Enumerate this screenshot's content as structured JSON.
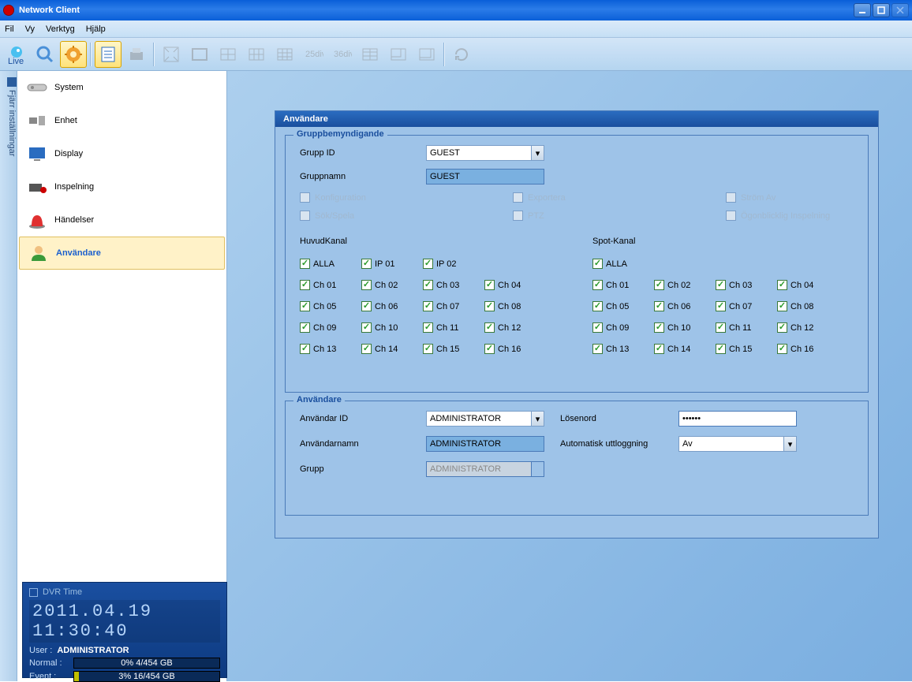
{
  "window": {
    "title": "Network Client"
  },
  "menu": {
    "fil": "Fil",
    "vy": "Vy",
    "verktyg": "Verktyg",
    "hjalp": "Hjälp"
  },
  "sidetab": {
    "label": "Fjärr inställningar"
  },
  "nav": {
    "system": "System",
    "enhet": "Enhet",
    "display": "Display",
    "inspelning": "Inspelning",
    "handelser": "Händelser",
    "anvandare": "Användare"
  },
  "panel": {
    "title": "Användare",
    "group_legend": "Gruppbemyndigande",
    "grupp_id_label": "Grupp ID",
    "grupp_id_value": "GUEST",
    "gruppnamn_label": "Gruppnamn",
    "gruppnamn_value": "GUEST",
    "perm_konfig": "Konfiguration",
    "perm_export": "Exportera",
    "perm_strom": "Ström Av",
    "perm_sok": "Sök/Spela",
    "perm_ptz": "PTZ",
    "perm_ogon": "Ögonblicklig Inspelning",
    "huvud_label": "HuvudKanal",
    "spot_label": "Spot-Kanal",
    "alla": "ALLA",
    "ip01": "IP 01",
    "ip02": "IP 02",
    "ch01": "Ch 01",
    "ch02": "Ch 02",
    "ch03": "Ch 03",
    "ch04": "Ch 04",
    "ch05": "Ch 05",
    "ch06": "Ch 06",
    "ch07": "Ch 07",
    "ch08": "Ch 08",
    "ch09": "Ch 09",
    "ch10": "Ch 10",
    "ch11": "Ch 11",
    "ch12": "Ch 12",
    "ch13": "Ch 13",
    "ch14": "Ch 14",
    "ch15": "Ch 15",
    "ch16": "Ch 16",
    "user_legend": "Användare",
    "anvandar_id_label": "Användar ID",
    "anvandar_id_value": "ADMINISTRATOR",
    "losenord_label": "Lösenord",
    "losenord_value": "••••••",
    "anvandarnamn_label": "Användarnamn",
    "anvandarnamn_value": "ADMINISTRATOR",
    "auto_label": "Automatisk uttloggning",
    "auto_value": "Av",
    "grupp_label": "Grupp",
    "grupp_value": "ADMINISTRATOR"
  },
  "status": {
    "dvr_label": "DVR Time",
    "time": "2011.04.19  11:30:40",
    "user_label": "User :",
    "user_value": "ADMINISTRATOR",
    "normal_label": "Normal :",
    "normal_value": "0% 4/454 GB",
    "event_label": "Event  :",
    "event_value": "3% 16/454 GB"
  }
}
